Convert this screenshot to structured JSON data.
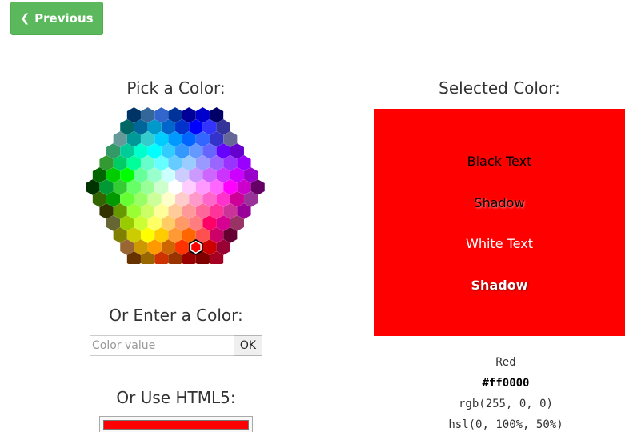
{
  "nav": {
    "previous_label": "Previous",
    "previous_icon": "chevron-left-icon"
  },
  "picker": {
    "pick_heading": "Pick a Color:",
    "enter_heading": "Or Enter a Color:",
    "input_placeholder": "Color value",
    "ok_label": "OK",
    "html5_heading": "Or Use HTML5:",
    "html5_value": "#ff0000",
    "selected_swatch": "#FF0000",
    "palette_rows": [
      [
        "#003366",
        "#336699",
        "#3366CC",
        "#003399",
        "#000099",
        "#0000CC",
        "#000066"
      ],
      [
        "#006666",
        "#006699",
        "#0099CC",
        "#0066CC",
        "#0033CC",
        "#0000FF",
        "#3333FF",
        "#333399"
      ],
      [
        "#669999",
        "#009999",
        "#33CCCC",
        "#00CCFF",
        "#0099FF",
        "#0066FF",
        "#3366FF",
        "#3333CC",
        "#666699"
      ],
      [
        "#339966",
        "#00CC99",
        "#00FFCC",
        "#00FFFF",
        "#33CCFF",
        "#3399FF",
        "#6699FF",
        "#6666FF",
        "#6600FF",
        "#6600CC"
      ],
      [
        "#339933",
        "#00CC66",
        "#00FF99",
        "#66FFCC",
        "#66FFFF",
        "#66CCFF",
        "#99CCFF",
        "#9999FF",
        "#9966FF",
        "#9933FF",
        "#9900FF"
      ],
      [
        "#006600",
        "#00CC00",
        "#00FF00",
        "#66FF99",
        "#99FFCC",
        "#CCFFFF",
        "#CCCCFF",
        "#CC99FF",
        "#CC66FF",
        "#CC33FF",
        "#CC00FF",
        "#9900CC"
      ],
      [
        "#003300",
        "#009933",
        "#33CC33",
        "#66FF66",
        "#99FF99",
        "#CCFFCC",
        "#FFFFFF",
        "#FFCCFF",
        "#FF99FF",
        "#FF66FF",
        "#FF00FF",
        "#CC00CC",
        "#660066"
      ],
      [
        "#336600",
        "#009900",
        "#66FF33",
        "#99FF66",
        "#CCFF99",
        "#FFFFCC",
        "#FFCCCC",
        "#FF99CC",
        "#FF66CC",
        "#FF33CC",
        "#CC0099",
        "#993399"
      ],
      [
        "#333300",
        "#669900",
        "#99FF33",
        "#CCFF66",
        "#FFFF99",
        "#FFCC99",
        "#FF9999",
        "#FF6699",
        "#FF3399",
        "#CC3399",
        "#990099"
      ],
      [
        "#666633",
        "#99CC00",
        "#CCFF33",
        "#FFFF66",
        "#FFCC66",
        "#FF9966",
        "#FF7C80",
        "#FF0066",
        "#D60093",
        "#993366"
      ],
      [
        "#808000",
        "#CCCC00",
        "#FFFF00",
        "#FFCC00",
        "#FF9933",
        "#FF6600",
        "#FF5050",
        "#CC0066",
        "#660033"
      ],
      [
        "#996633",
        "#CC9900",
        "#FF9900",
        "#CC6600",
        "#FF3300",
        "#FF0000",
        "#CC0000",
        "#990033"
      ],
      [
        "#663300",
        "#996600",
        "#CC3300",
        "#993300",
        "#990000",
        "#800000",
        "#A50021"
      ]
    ]
  },
  "selected": {
    "heading": "Selected Color:",
    "swatch": "#FF0000",
    "black_text": "Black Text",
    "shadow_dark": "Shadow",
    "white_text": "White Text",
    "shadow_light": "Shadow",
    "name": "Red",
    "hex": "#ff0000",
    "rgb": "rgb(255, 0, 0)",
    "hsl": "hsl(0, 100%, 50%)"
  }
}
